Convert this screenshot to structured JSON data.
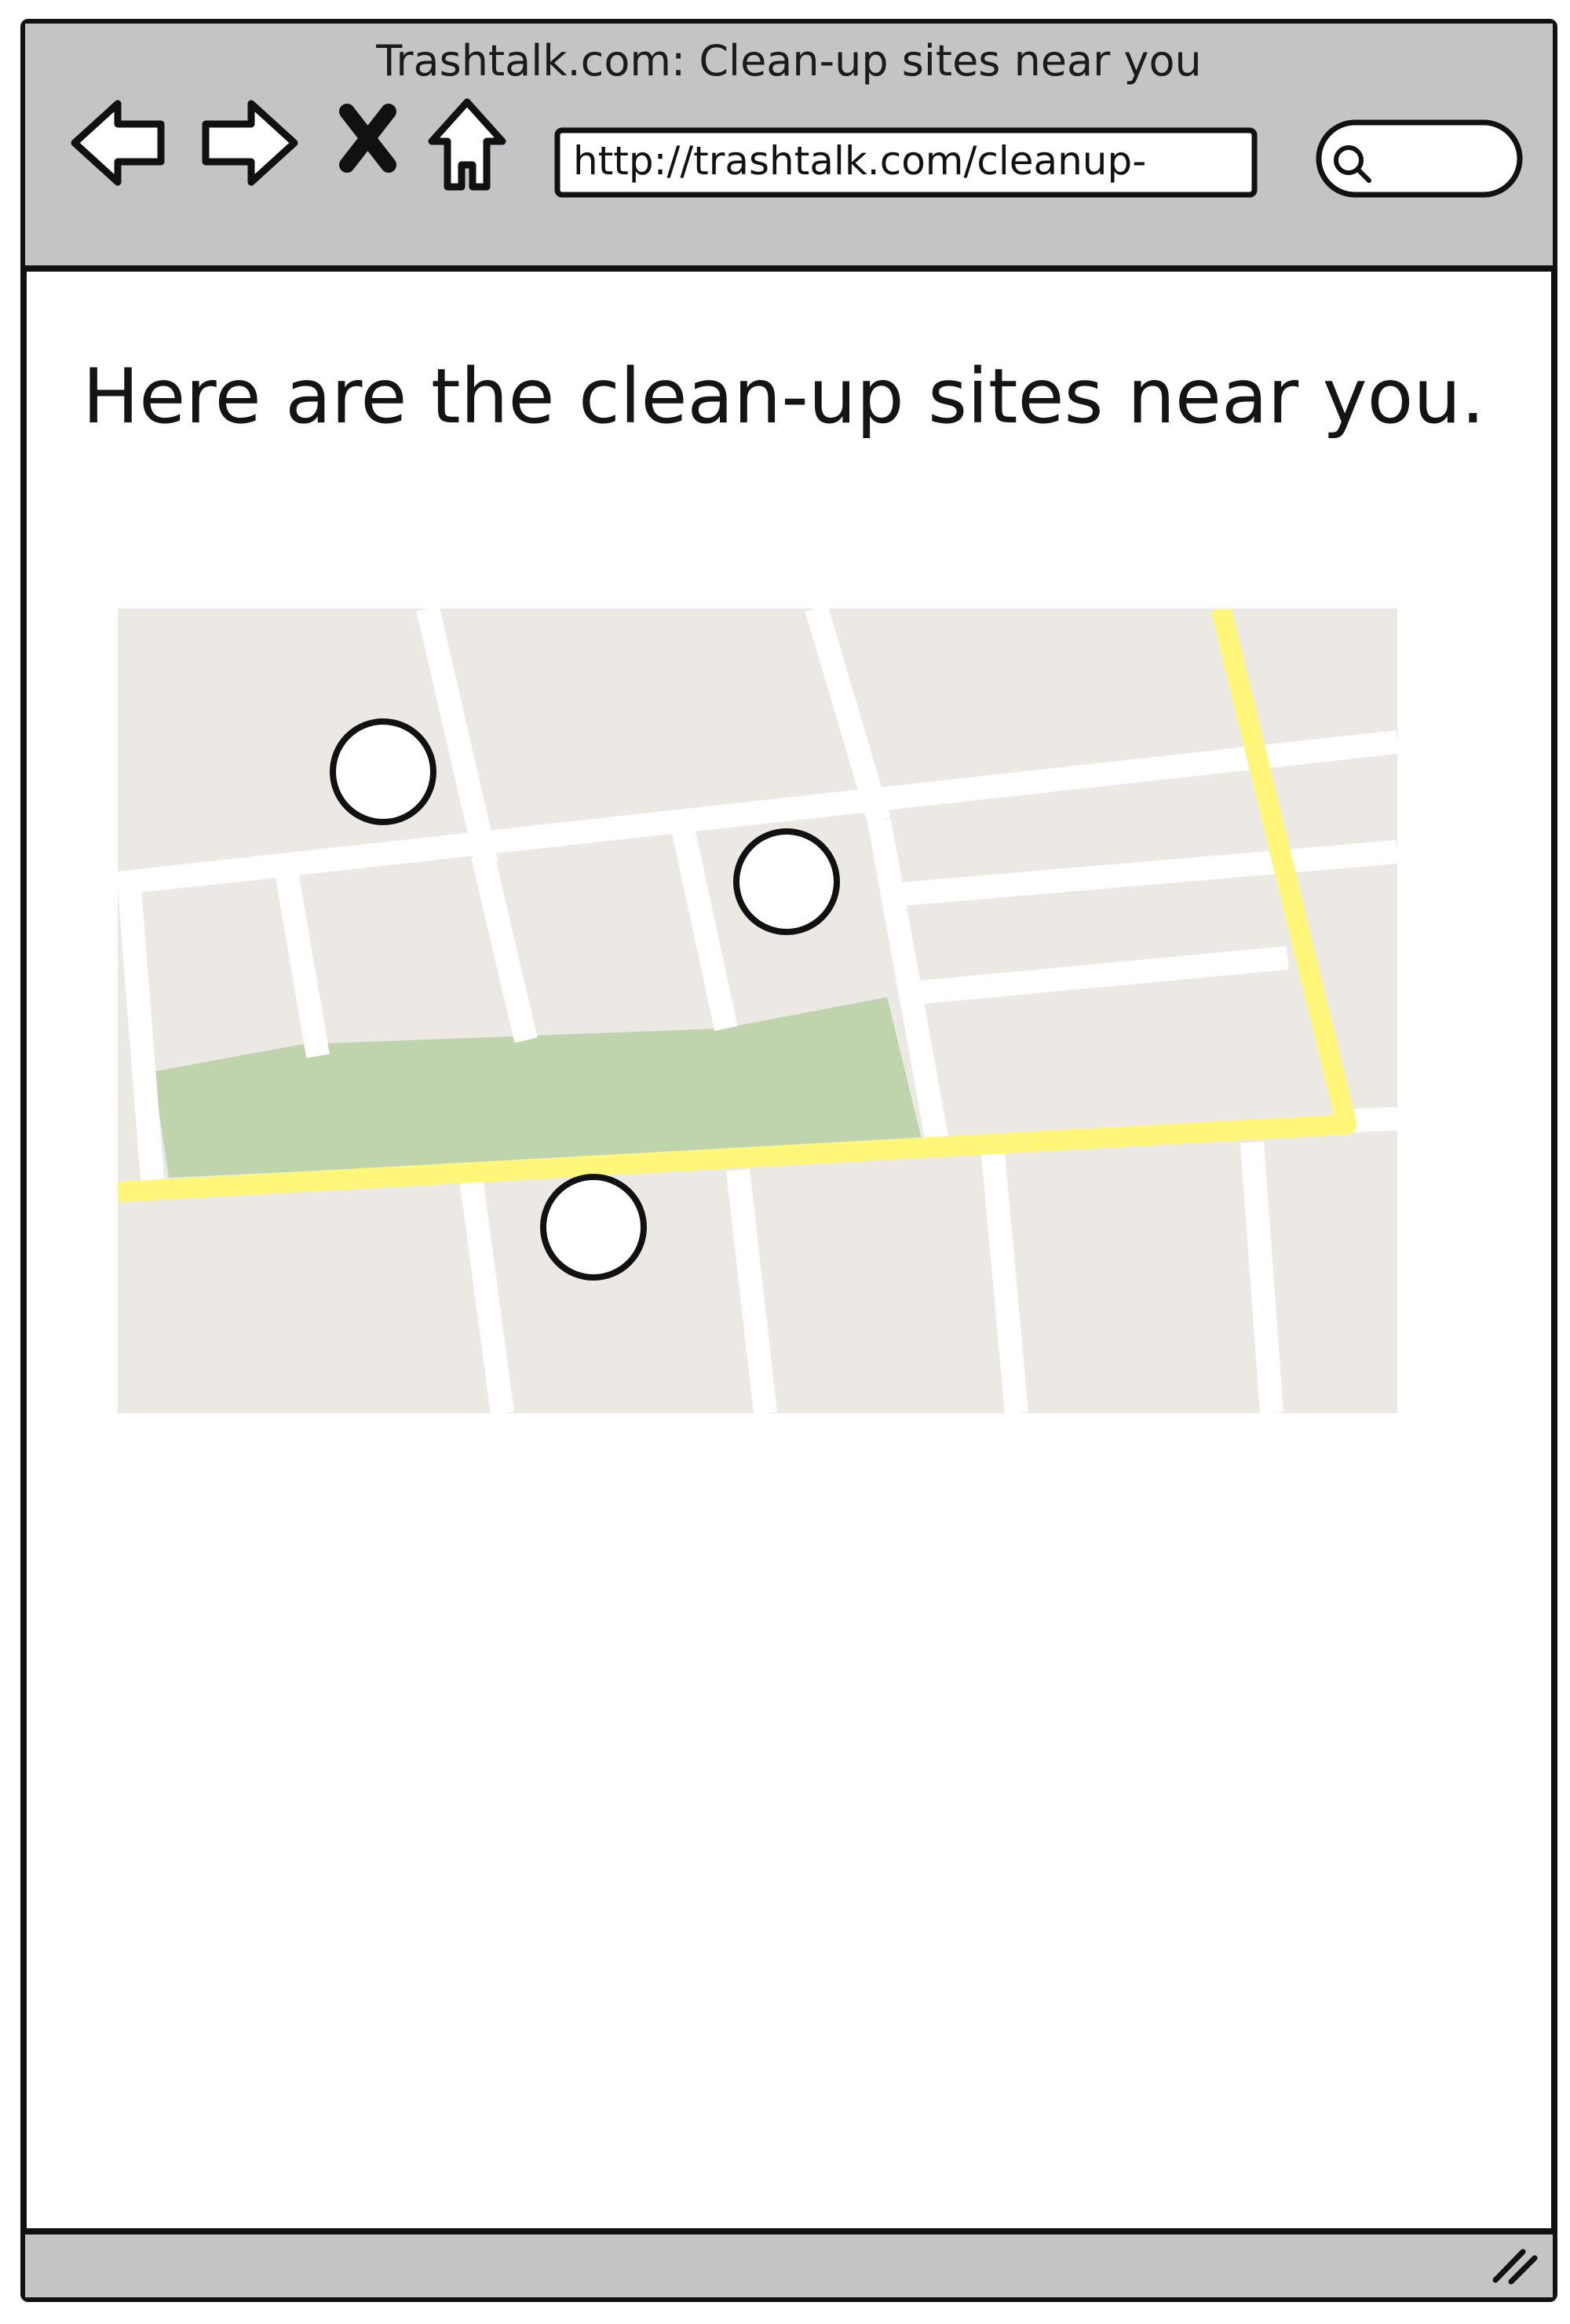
{
  "browser": {
    "title": "Trashtalk.com: Clean-up sites near you",
    "url": "http://trashtalk.com/cleanup-",
    "search_placeholder": ""
  },
  "page": {
    "headline": "Here are the clean-up sites near you."
  },
  "map": {
    "sites_count": 3,
    "colors": {
      "block": "#ece9e4",
      "road": "#ffffff",
      "highway": "#fff67a",
      "park": "#bfd4ac",
      "marker_fill": "#ffffff",
      "marker_stroke": "#111111"
    }
  },
  "icons": [
    "back-arrow-icon",
    "forward-arrow-icon",
    "stop-icon",
    "home-icon",
    "search-icon",
    "resize-grip-icon"
  ]
}
